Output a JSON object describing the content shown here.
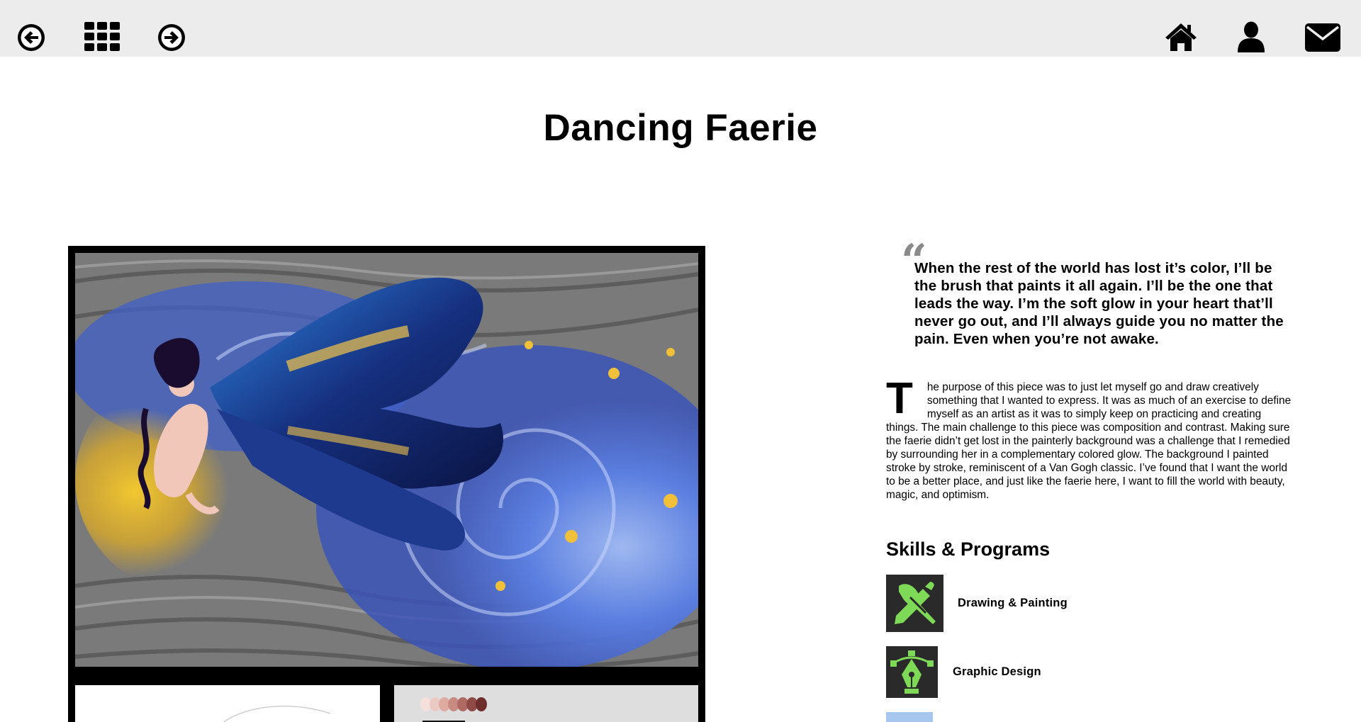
{
  "header": {
    "nav_left": [
      "back-arrow-icon",
      "grid-icon",
      "forward-arrow-icon"
    ],
    "nav_right": [
      "home-icon",
      "user-icon",
      "mail-icon"
    ]
  },
  "page": {
    "title": "Dancing Faerie"
  },
  "quote": {
    "mark": "“",
    "text": "When the rest of the world has lost it’s color, I’ll be the brush that paints it all again. I’ll be the one that leads the way. I’m the soft glow in your heart that’ll never go out, and I’ll always guide you no matter the pain. Even when you’re not awake."
  },
  "description": {
    "drop_cap": "T",
    "text": "he purpose of this piece was to just let myself go and draw creatively something that I wanted to express. It was as much of an exercise to define myself as an artist as it was to simply keep on practicing and creating things. The main challenge to this piece was composition and contrast. Making sure the faerie didn’t get lost in the painterly background was a challenge that I remedied by surrounding her in a complementary colored glow. The background I painted stroke by stroke, reminiscent of a Van Gogh classic. I’ve found that I want the world to be a better place, and just like the faerie here, I want to fill the world with beauty, magic, and optimism."
  },
  "skills": {
    "heading": "Skills & Programs",
    "items": [
      {
        "label": "Drawing & Painting",
        "icon": "brush-pencil-icon"
      },
      {
        "label": "Graphic Design",
        "icon": "pen-tool-icon"
      },
      {
        "label": "",
        "icon": "program-icon"
      }
    ]
  },
  "colors": {
    "topbar": "#ececec",
    "accent_green": "#7ed957",
    "icon_bg": "#2a2a2a",
    "art_blue": "#2a5bd7",
    "art_gold": "#e8b92a"
  }
}
